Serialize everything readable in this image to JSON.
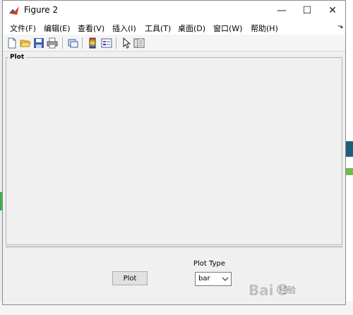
{
  "window": {
    "title": "Figure 2",
    "controls": {
      "minimize": "—",
      "maximize": "☐",
      "close": "✕"
    }
  },
  "menubar": {
    "items": [
      "文件(F)",
      "编辑(E)",
      "查看(V)",
      "插入(I)",
      "工具(T)",
      "桌面(D)",
      "窗口(W)",
      "帮助(H)"
    ],
    "overflow_arrow": "⬎"
  },
  "toolbar": {
    "icons": [
      "new-figure-icon",
      "open-file-icon",
      "save-icon",
      "print-icon",
      "link-plot-icon",
      "colorbar-icon",
      "legend-icon",
      "pointer-icon",
      "property-inspector-icon"
    ]
  },
  "plot_panel": {
    "title": "Plot"
  },
  "controls": {
    "plot_button_label": "Plot",
    "plot_type_label": "Plot Type",
    "plot_type_value": "bar"
  },
  "watermark": {
    "text": "经验",
    "logo": "Bai du"
  }
}
